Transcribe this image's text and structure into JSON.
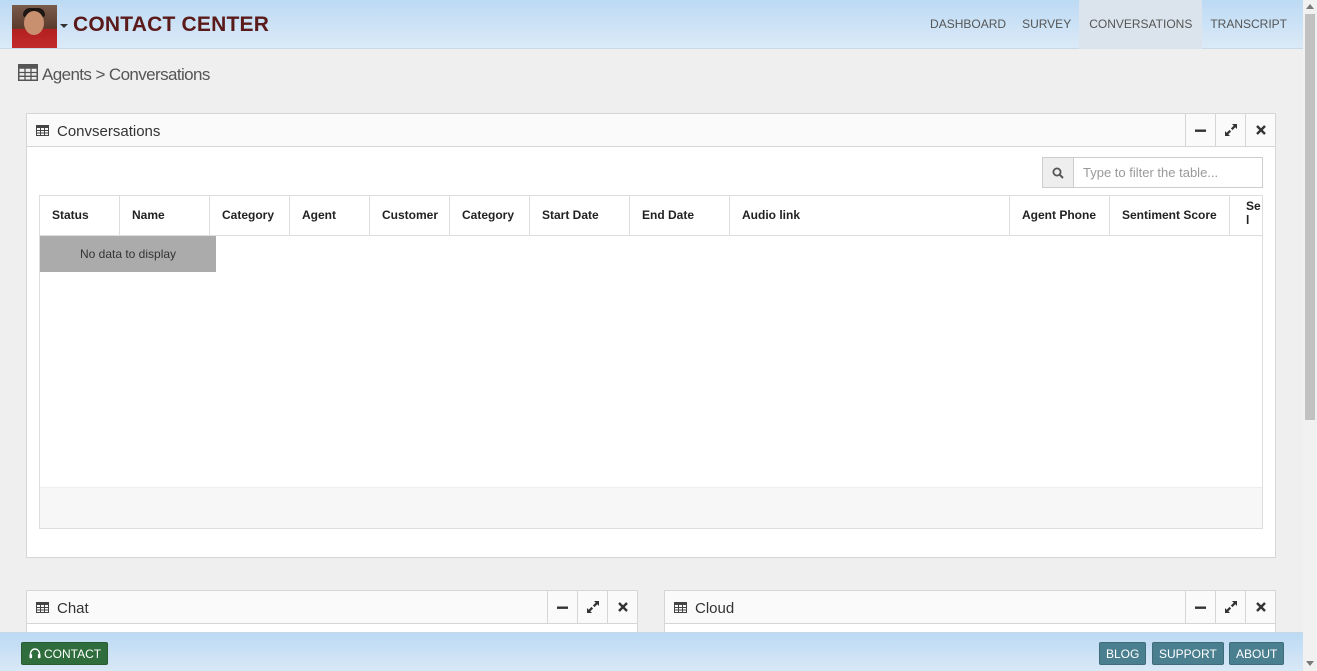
{
  "header": {
    "brand": "CONTACT CENTER",
    "nav": [
      "DASHBOARD",
      "SURVEY",
      "CONVERSATIONS",
      "TRANSCRIPT"
    ],
    "active_nav": "CONVERSATIONS"
  },
  "breadcrumb": {
    "text": "Agents > Conversations"
  },
  "conversations": {
    "title": "Convsersations",
    "search_placeholder": "Type to filter the table...",
    "columns": [
      "Status",
      "Name",
      "Category",
      "Agent",
      "Customer",
      "Category",
      "Start Date",
      "End Date",
      "Audio link",
      "Agent Phone",
      "Sentiment Score",
      "Se\nl"
    ],
    "empty_text": "No data to display"
  },
  "chat": {
    "title": "Chat"
  },
  "cloud": {
    "title": "Cloud"
  },
  "footer": {
    "contact": "CONTACT",
    "blog": "BLOG",
    "support": "SUPPORT",
    "about": "ABOUT"
  },
  "icons": {
    "table": "table-icon",
    "minimize": "minus-icon",
    "expand": "expand-icon",
    "close": "close-icon",
    "search": "search-icon",
    "headset": "headset-icon"
  }
}
